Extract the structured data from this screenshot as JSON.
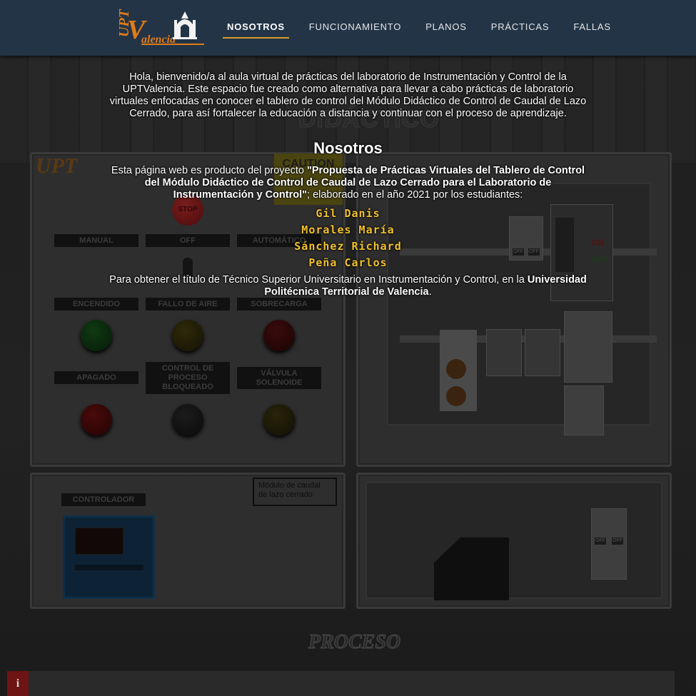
{
  "nav": {
    "logo_text": "UPT Valencia",
    "items": [
      {
        "label": "NOSOTROS",
        "active": true
      },
      {
        "label": "FUNCIONAMIENTO",
        "active": false
      },
      {
        "label": "PLANOS",
        "active": false
      },
      {
        "label": "PRÁCTICAS",
        "active": false
      },
      {
        "label": "FALLAS",
        "active": false
      }
    ]
  },
  "intro": "Hola, bienvenido/a al aula virtual de prácticas del laboratorio de Instrumentación y Control de la UPTValencia. Este espacio fue creado como alternativa para llevar a cabo prácticas de laboratorio virtuales enfocadas en conocer el tablero de control del Módulo Didáctico de Control de Caudal de Lazo Cerrado, para así fortalecer la educación a distancia y continuar con el proceso de aprendizaje.",
  "section": {
    "heading": "Nosotros",
    "project_prefix": "Esta página web es producto del proyecto ",
    "project_title": "\"Propuesta de Prácticas Virtuales del Tablero de Control del Módulo Didáctico de Control de Caudal de Lazo Cerrado para el Laboratorio de Instrumentación y Control\"",
    "project_suffix": "; elaborado en el año 2021 por los estudiantes:",
    "students": [
      "Gil Danis",
      "Morales María",
      "Sánchez Richard",
      "Peña Carlos"
    ],
    "title_prefix": "Para obtener el título de Técnico Superior Universitario en Instrumentación y Control, en la ",
    "university": "Universidad Politécnica Territorial de Valencia",
    "title_suffix": "."
  },
  "background": {
    "didactico": "DIDÁCTICO",
    "caution": "CAUTION",
    "stop": "STOP",
    "labels_row1": [
      "MANUAL",
      "OFF",
      "AUTOMÁTICO"
    ],
    "labels_row2": [
      "ENCENDIDO",
      "FALLO DE AIRE",
      "SOBRECARGA"
    ],
    "labels_row3": [
      "APAGADO",
      "CONTROL DE PROCESO BLOQUEADO",
      "VÁLVULA SOLENOIDE"
    ],
    "controlador": "CONTROLADOR",
    "modulo": "Módulo de caudal de lazo cerrado",
    "breaker_off": "OFF",
    "breaker_on": "ON",
    "proceso": "PROCESO"
  },
  "info_icon": "i",
  "colors": {
    "navbar": "#233447",
    "accent": "#d99a2b",
    "student_names": "#f2c22c",
    "info_button": "#6e1414"
  }
}
